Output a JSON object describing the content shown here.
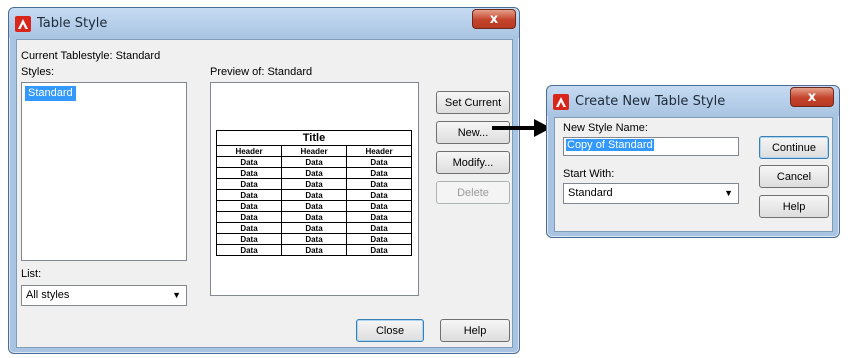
{
  "main_dialog": {
    "title": "Table Style",
    "current_label": "Current Tablestyle: Standard",
    "styles_label": "Styles:",
    "styles": [
      "Standard"
    ],
    "preview_label": "Preview of: Standard",
    "list_label": "List:",
    "list_value": "All styles",
    "buttons": {
      "set_current": "Set Current",
      "new": "New...",
      "modify": "Modify...",
      "delete": "Delete",
      "close": "Close",
      "help": "Help"
    },
    "close_glyph": "x"
  },
  "preview_table": {
    "title": "Title",
    "headers": [
      "Header",
      "Header",
      "Header"
    ],
    "rows": [
      [
        "Data",
        "Data",
        "Data"
      ],
      [
        "Data",
        "Data",
        "Data"
      ],
      [
        "Data",
        "Data",
        "Data"
      ],
      [
        "Data",
        "Data",
        "Data"
      ],
      [
        "Data",
        "Data",
        "Data"
      ],
      [
        "Data",
        "Data",
        "Data"
      ],
      [
        "Data",
        "Data",
        "Data"
      ],
      [
        "Data",
        "Data",
        "Data"
      ],
      [
        "Data",
        "Data",
        "Data"
      ]
    ]
  },
  "new_dialog": {
    "title": "Create New Table Style",
    "name_label": "New Style Name:",
    "name_value": "Copy of Standard",
    "start_label": "Start With:",
    "start_value": "Standard",
    "buttons": {
      "continue": "Continue",
      "cancel": "Cancel",
      "help": "Help"
    },
    "close_glyph": "x"
  },
  "colors": {
    "selection": "#3399ff",
    "window_frame": "#a9c4e2",
    "close_button": "#c4432b",
    "app_icon": "#d9261c"
  }
}
